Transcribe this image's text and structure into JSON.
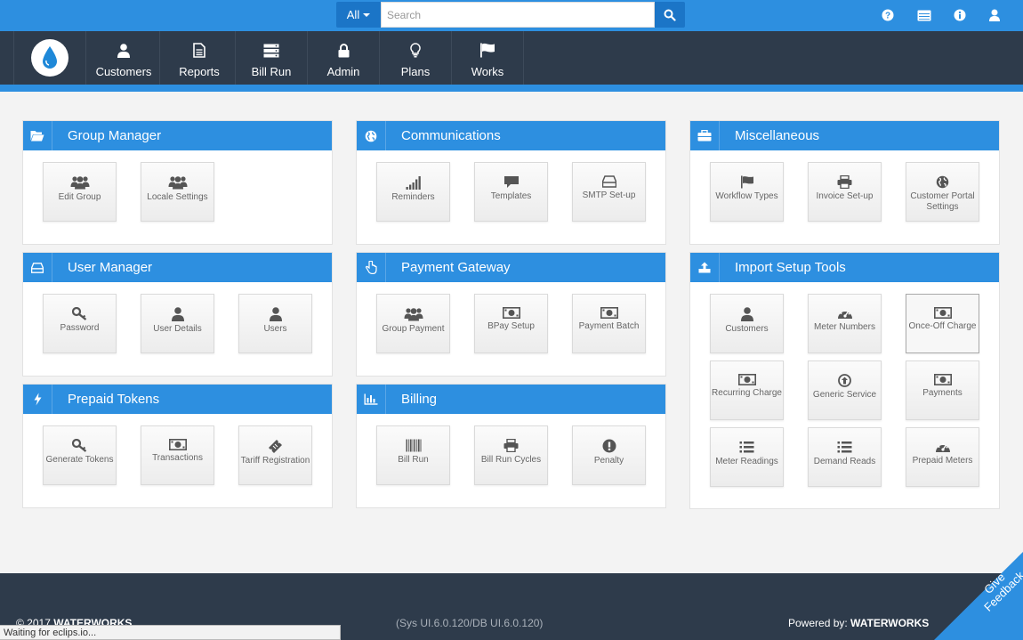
{
  "topbar": {
    "scope_label": "All",
    "search_placeholder": "Search"
  },
  "nav": {
    "items": [
      {
        "label": "Customers",
        "icon": "user-icon"
      },
      {
        "label": "Reports",
        "icon": "document-icon"
      },
      {
        "label": "Bill Run",
        "icon": "server-icon"
      },
      {
        "label": "Admin",
        "icon": "lock-icon"
      },
      {
        "label": "Plans",
        "icon": "lightbulb-icon"
      },
      {
        "label": "Works",
        "icon": "flag-icon"
      }
    ]
  },
  "panels": {
    "group_manager": {
      "title": "Group Manager",
      "tiles": [
        "Edit Group",
        "Locale Settings"
      ]
    },
    "communications": {
      "title": "Communications",
      "tiles": [
        "Reminders",
        "Templates",
        "SMTP Set-up"
      ]
    },
    "miscellaneous": {
      "title": "Miscellaneous",
      "tiles": [
        "Workflow Types",
        "Invoice Set-up",
        "Customer Portal Settings"
      ]
    },
    "user_manager": {
      "title": "User Manager",
      "tiles": [
        "Password",
        "User Details",
        "Users"
      ]
    },
    "payment_gateway": {
      "title": "Payment Gateway",
      "tiles": [
        "Group Payment",
        "BPay Setup",
        "Payment Batch"
      ]
    },
    "import_setup_tools": {
      "title": "Import Setup Tools",
      "tiles": [
        "Customers",
        "Meter Numbers",
        "Once-Off Charge",
        "Recurring Charge",
        "Generic Service",
        "Payments",
        "Meter Readings",
        "Demand Reads",
        "Prepaid Meters"
      ]
    },
    "prepaid_tokens": {
      "title": "Prepaid Tokens",
      "tiles": [
        "Generate Tokens",
        "Transactions",
        "Tariff Registration"
      ]
    },
    "billing": {
      "title": "Billing",
      "tiles": [
        "Bill Run",
        "Bill Run Cycles",
        "Penalty"
      ]
    }
  },
  "footer": {
    "copyright_prefix": "© 2017",
    "copyright_brand": "WATERWORKS",
    "version": "(Sys UI.6.0.120/DB UI.6.0.120)",
    "powered_prefix": "Powered by:",
    "powered_brand": "WATERWORKS"
  },
  "status_bar": "Waiting for eclips.io...",
  "feedback": {
    "line1": "Give",
    "line2": "Feedback"
  },
  "colors": {
    "primary": "#2d8fe0",
    "dark": "#2e3b4b",
    "accent": "#1b75c7"
  }
}
